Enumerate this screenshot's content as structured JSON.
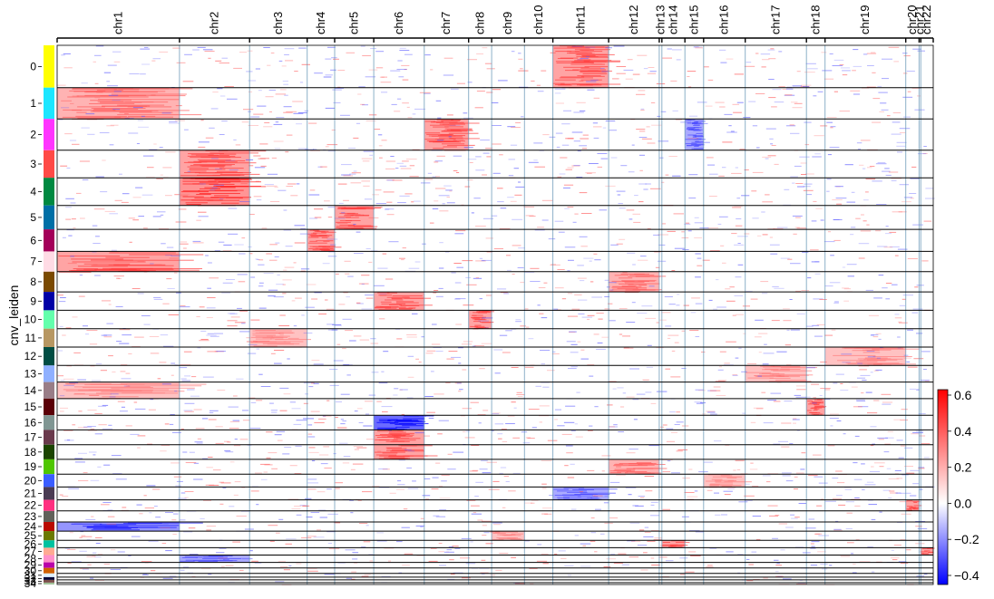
{
  "chart_data": {
    "type": "heatmap",
    "title": "",
    "ylabel": "cnv_leiden",
    "xlabel": "",
    "x_categories": [
      "chr1",
      "chr2",
      "chr3",
      "chr4",
      "chr5",
      "chr6",
      "chr7",
      "chr8",
      "chr9",
      "chr10",
      "chr11",
      "chr12",
      "chr13",
      "chr14",
      "chr15",
      "chr16",
      "chr17",
      "chr18",
      "chr19",
      "chr20",
      "chr21",
      "chr22"
    ],
    "chromosome_widths": [
      138,
      79,
      65,
      31,
      44,
      57,
      50,
      26,
      37,
      32,
      63,
      57,
      3,
      26,
      21,
      47,
      69,
      21,
      91,
      15,
      2,
      14
    ],
    "y_categories": [
      "0",
      "1",
      "2",
      "3",
      "4",
      "5",
      "6",
      "7",
      "8",
      "9",
      "10",
      "11",
      "12",
      "13",
      "14",
      "15",
      "16",
      "17",
      "18",
      "19",
      "20",
      "21",
      "22",
      "23",
      "24",
      "25",
      "26",
      "27",
      "28",
      "29",
      "30",
      "31",
      "32",
      "33",
      "34"
    ],
    "cluster_sizes": [
      46,
      34,
      34,
      30,
      30,
      26,
      24,
      22,
      22,
      20,
      20,
      20,
      20,
      18,
      18,
      18,
      16,
      16,
      16,
      16,
      14,
      14,
      12,
      12,
      10,
      10,
      8,
      8,
      8,
      6,
      6,
      4,
      3,
      3,
      2
    ],
    "cluster_colors": [
      "#ffff00",
      "#1ce6ff",
      "#ff34ff",
      "#ff4a46",
      "#008941",
      "#006fa6",
      "#a30059",
      "#ffdbe5",
      "#7a4900",
      "#0000a6",
      "#63ffac",
      "#b79762",
      "#004d43",
      "#8fb0ff",
      "#997d87",
      "#5a0007",
      "#809693",
      "#6a3a4c",
      "#1b4400",
      "#4fc601",
      "#3b5dff",
      "#4a3b53",
      "#ff2f80",
      "#61615a",
      "#ba0900",
      "#6b7900",
      "#00c2a0",
      "#ffaa92",
      "#ff90c9",
      "#b903aa",
      "#d16100",
      "#ddefff",
      "#000035",
      "#7b4f4b",
      "#a1c299"
    ],
    "signals": [
      {
        "cluster": "0",
        "chromosome": "chr11",
        "value": 0.3
      },
      {
        "cluster": "1",
        "chromosome": "chr1",
        "value": 0.25
      },
      {
        "cluster": "2",
        "chromosome": "chr7",
        "value": 0.3
      },
      {
        "cluster": "2",
        "chromosome": "chr15",
        "value": -0.2
      },
      {
        "cluster": "3",
        "chromosome": "chr2",
        "value": 0.3
      },
      {
        "cluster": "4",
        "chromosome": "chr2",
        "value": 0.35
      },
      {
        "cluster": "5",
        "chromosome": "chr5",
        "value": 0.3
      },
      {
        "cluster": "6",
        "chromosome": "chr4",
        "value": 0.3
      },
      {
        "cluster": "7",
        "chromosome": "chr1",
        "value": 0.3
      },
      {
        "cluster": "8",
        "chromosome": "chr12",
        "value": 0.25
      },
      {
        "cluster": "9",
        "chromosome": "chr6",
        "value": 0.3
      },
      {
        "cluster": "10",
        "chromosome": "chr8",
        "value": 0.3
      },
      {
        "cluster": "11",
        "chromosome": "chr3",
        "value": 0.2
      },
      {
        "cluster": "12",
        "chromosome": "chr19",
        "value": 0.2
      },
      {
        "cluster": "13",
        "chromosome": "chr17",
        "value": 0.2
      },
      {
        "cluster": "14",
        "chromosome": "chr1",
        "value": 0.2
      },
      {
        "cluster": "15",
        "chromosome": "chr18",
        "value": 0.3
      },
      {
        "cluster": "16",
        "chromosome": "chr6",
        "value": -0.35
      },
      {
        "cluster": "17",
        "chromosome": "chr6",
        "value": 0.3
      },
      {
        "cluster": "18",
        "chromosome": "chr6",
        "value": 0.3
      },
      {
        "cluster": "19",
        "chromosome": "chr12",
        "value": 0.25
      },
      {
        "cluster": "20",
        "chromosome": "chr16",
        "value": 0.2
      },
      {
        "cluster": "21",
        "chromosome": "chr11",
        "value": -0.2
      },
      {
        "cluster": "22",
        "chromosome": "chr20",
        "value": 0.3
      },
      {
        "cluster": "24",
        "chromosome": "chr1",
        "value": -0.25
      },
      {
        "cluster": "25",
        "chromosome": "chr9",
        "value": 0.2
      },
      {
        "cluster": "26",
        "chromosome": "chr14",
        "value": 0.3
      },
      {
        "cluster": "27",
        "chromosome": "chr22",
        "value": 0.3
      },
      {
        "cluster": "28",
        "chromosome": "chr2",
        "value": -0.2
      }
    ],
    "colorbar": {
      "range": [
        -0.45,
        0.63
      ],
      "ticks": [
        0.6,
        0.4,
        0.2,
        0.0,
        -0.2,
        -0.4
      ],
      "tick_labels": [
        "0.6",
        "0.4",
        "0.2",
        "0.0",
        "−0.2",
        "−0.4"
      ],
      "colors": [
        "#0000ff",
        "#ffffff",
        "#ff0000"
      ]
    }
  }
}
